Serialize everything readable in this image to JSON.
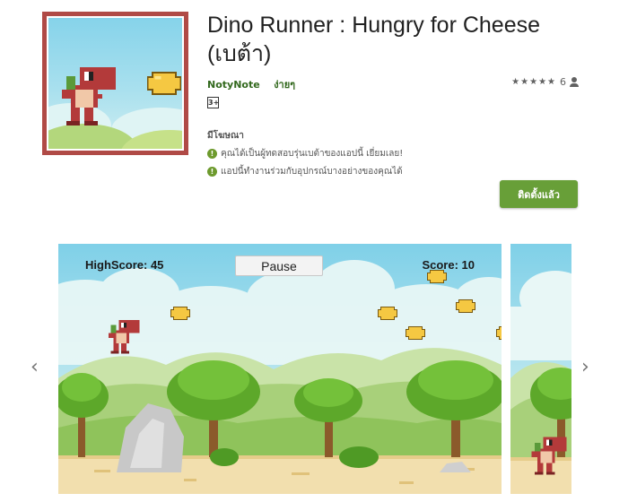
{
  "app": {
    "title": "Dino Runner : Hungry for Cheese (เบต้า)",
    "developer": "NotyNote",
    "category": "ง่ายๆ",
    "rating_stars": "★★★★★",
    "rating_count": "6",
    "age_rating": "3+",
    "ads_label": "มีโฆษณา",
    "notices": [
      "คุณได้เป็นผู้ทดสอบรุ่นเบต้าของแอปนี้ เยี่ยมเลย!",
      "แอปนี้ทำงานร่วมกับอุปกรณ์บางอย่างของคุณได้"
    ],
    "install_label": "ติดตั้งแล้ว"
  },
  "icons": {
    "info": "info-circle-icon",
    "user": "person-icon",
    "prev": "chevron-left-icon",
    "next": "chevron-right-icon",
    "prev_glyph": "‹",
    "next_glyph": "›",
    "info_glyph": "!"
  },
  "screenshot": {
    "highscore_label": "HighScore: 45",
    "score_label": "Score: 10",
    "pause_label": "Pause"
  },
  "colors": {
    "install_green": "#689f38",
    "developer_green": "#33691e",
    "icon_border": "#b04a46",
    "dino_red": "#b33a3a",
    "cheese": "#f5c842",
    "sky": "#86d3ea"
  }
}
